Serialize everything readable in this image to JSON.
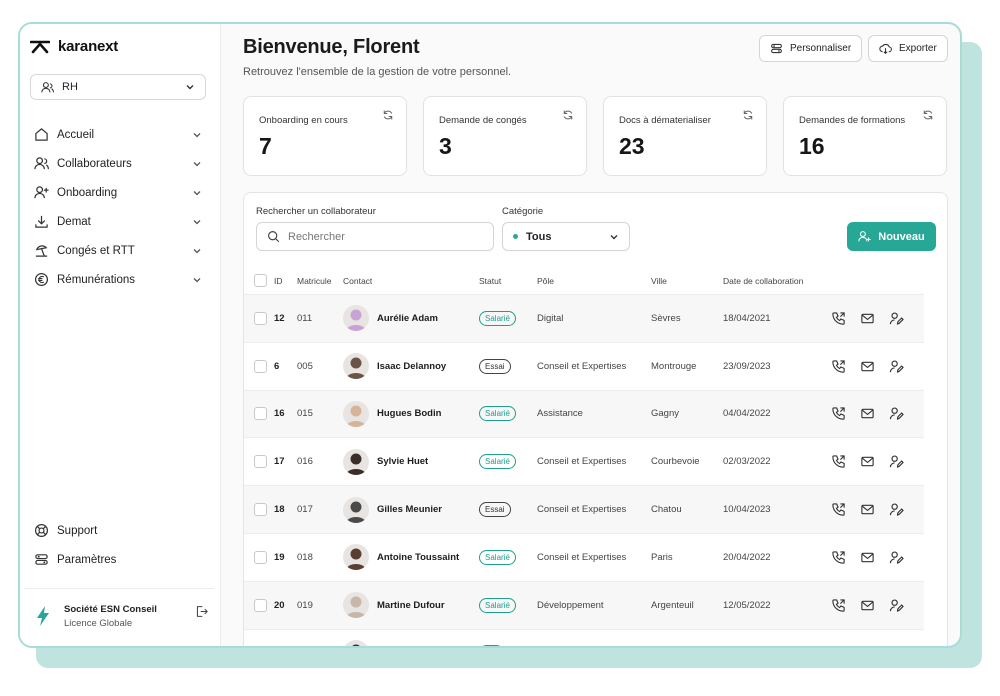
{
  "app": {
    "name": "karanext"
  },
  "sidebar": {
    "role": "RH",
    "items": [
      {
        "label": "Accueil",
        "icon": "home-icon"
      },
      {
        "label": "Collaborateurs",
        "icon": "users-icon"
      },
      {
        "label": "Onboarding",
        "icon": "user-plus-icon"
      },
      {
        "label": "Demat",
        "icon": "download-icon"
      },
      {
        "label": "Congés et RTT",
        "icon": "beach-icon"
      },
      {
        "label": "Rémunérations",
        "icon": "euro-icon"
      }
    ],
    "bottom": [
      {
        "label": "Support",
        "icon": "lifebuoy-icon"
      },
      {
        "label": "Paramètres",
        "icon": "settings-icon"
      }
    ],
    "org": {
      "name": "Société ESN Conseil",
      "license": "Licence Globale"
    }
  },
  "header": {
    "title": "Bienvenue, Florent",
    "subtitle": "Retrouvez l'ensemble de la gestion de votre personnel.",
    "customize_label": "Personnaliser",
    "export_label": "Exporter"
  },
  "stats": [
    {
      "label": "Onboarding en cours",
      "value": "7"
    },
    {
      "label": "Demande de congés",
      "value": "3"
    },
    {
      "label": "Docs à dématerialiser",
      "value": "23"
    },
    {
      "label": "Demandes de formations",
      "value": "16"
    }
  ],
  "filters": {
    "search_label": "Rechercher un collaborateur",
    "search_placeholder": "Rechercher",
    "category_label": "Catégorie",
    "category_value": "Tous",
    "new_label": "Nouveau"
  },
  "table": {
    "columns": {
      "id": "ID",
      "matricule": "Matricule",
      "contact": "Contact",
      "statut": "Statut",
      "pole": "Pôle",
      "ville": "Ville",
      "date": "Date de collaboration"
    },
    "rows": [
      {
        "id": "12",
        "matricule": "011",
        "name": "Aurélie Adam",
        "statut": "Salarié",
        "type": "salarie",
        "pole": "Digital",
        "ville": "Sèvres",
        "date": "18/04/2021",
        "avatar": "#c9a3d6"
      },
      {
        "id": "6",
        "matricule": "005",
        "name": "Isaac Delannoy",
        "statut": "Essai",
        "type": "essai",
        "pole": "Conseil et Expertises",
        "ville": "Montrouge",
        "date": "23/09/2023",
        "avatar": "#6b5447"
      },
      {
        "id": "16",
        "matricule": "015",
        "name": "Hugues Bodin",
        "statut": "Salarié",
        "type": "salarie",
        "pole": "Assistance",
        "ville": "Gagny",
        "date": "04/04/2022",
        "avatar": "#d6b49a"
      },
      {
        "id": "17",
        "matricule": "016",
        "name": "Sylvie Huet",
        "statut": "Salarié",
        "type": "salarie",
        "pole": "Conseil et Expertises",
        "ville": "Courbevoie",
        "date": "02/03/2022",
        "avatar": "#3a2e2a"
      },
      {
        "id": "18",
        "matricule": "017",
        "name": "Gilles Meunier",
        "statut": "Essai",
        "type": "essai",
        "pole": "Conseil et Expertises",
        "ville": "Chatou",
        "date": "10/04/2023",
        "avatar": "#4a4a4a"
      },
      {
        "id": "19",
        "matricule": "018",
        "name": "Antoine Toussaint",
        "statut": "Salarié",
        "type": "salarie",
        "pole": "Conseil et Expertises",
        "ville": "Paris",
        "date": "20/04/2022",
        "avatar": "#5a3f30"
      },
      {
        "id": "20",
        "matricule": "019",
        "name": "Martine Dufour",
        "statut": "Salarié",
        "type": "salarie",
        "pole": "Développement",
        "ville": "Argenteuil",
        "date": "12/05/2022",
        "avatar": "#c8b7a8"
      },
      {
        "id": "",
        "matricule": "",
        "name": "",
        "statut": "",
        "type": "salarie",
        "pole": "",
        "ville": "",
        "date": "",
        "avatar": "#2e2e2e"
      }
    ]
  },
  "colors": {
    "accent": "#27a796",
    "frame": "#a9dcd6",
    "shadow": "#bfe3df"
  }
}
